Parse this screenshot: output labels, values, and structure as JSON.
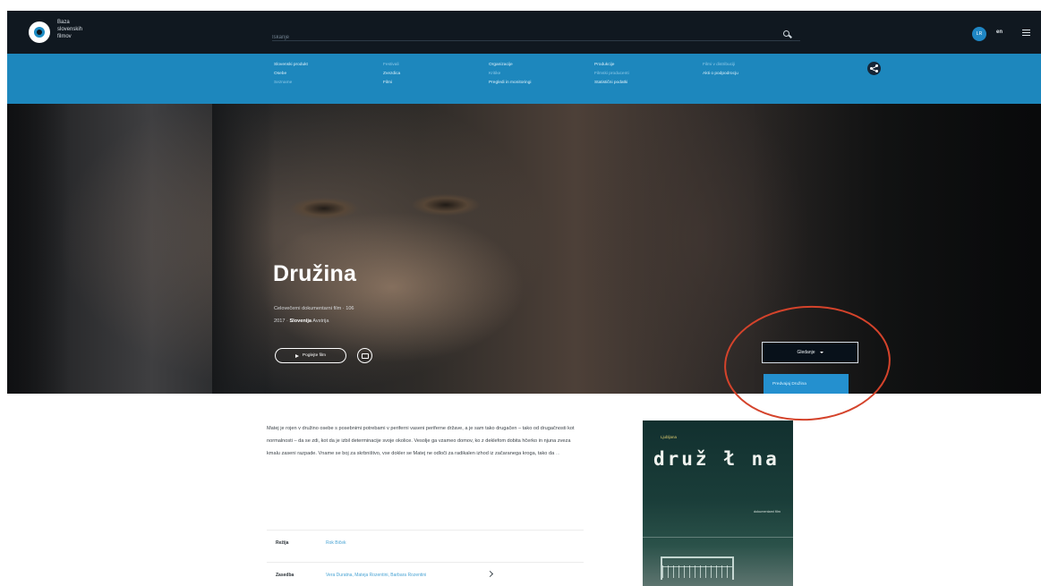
{
  "header": {
    "brand_lines": [
      "Baza",
      "slovenskih",
      "filmov"
    ],
    "search_placeholder": "Iskanje",
    "user_initials": "LR",
    "language": "en"
  },
  "nav": {
    "columns": [
      {
        "items": [
          {
            "label": "Slovenski produkt",
            "dim": false
          },
          {
            "label": "Osebe",
            "dim": false
          },
          {
            "label": "Sezname",
            "dim": true
          }
        ]
      },
      {
        "items": [
          {
            "label": "Festivali",
            "dim": true
          },
          {
            "label": "Zvezdica",
            "dim": false
          },
          {
            "label": "Filmi",
            "dim": false
          }
        ]
      },
      {
        "items": [
          {
            "label": "Organizacije",
            "dim": false
          },
          {
            "label": "Kritike",
            "dim": true
          },
          {
            "label": "Pregledi in monitoringi",
            "dim": false
          }
        ]
      },
      {
        "items": [
          {
            "label": "Produkcije",
            "dim": false
          },
          {
            "label": "Filmski producenti",
            "dim": true
          },
          {
            "label": "Statistični podatki",
            "dim": false
          }
        ]
      },
      {
        "items": [
          {
            "label": "Filmi v distribuciji",
            "dim": true
          },
          {
            "label": "Akti o podpodrocju",
            "dim": false
          }
        ]
      }
    ]
  },
  "hero": {
    "title": "Družina",
    "meta_line1": "Celovečerni dokumentarni film  ·  106",
    "meta_year": "2017",
    "meta_country": "Slovenija",
    "meta_extra": "Avstrija",
    "watch_label": "Poglejte film",
    "dropdown_label": "Gledanje",
    "dropdown_option": "Predvajaj Družina"
  },
  "content": {
    "synopsis": "Matej je rojen v družino osebe s posebnimi potrebami v periferni vaseni periferne države, a je sam tako drugačen – tako od drugačnosti kot normalnosti – da se zdi, kot da je izbil determinacije svoje okolice. Vesolje ga vzameo domov, ko z deklefom dobita hčerko in njuna zveza kmalu zaseni razpade. Vname se boj za skrbništvo, vse dokler se Matej ne odloči za radikalen izhod iz začaranega kroga, tako da",
    "more_label": "...",
    "meta_rows": [
      {
        "label": "Režija",
        "value": "Rok Biček"
      },
      {
        "label": "Zasedba",
        "value": "Vera Duratna, Mateja Rozentini, Barbara Rozentini"
      }
    ]
  },
  "poster": {
    "top_text": "Ljubljana",
    "title": "druž ł na",
    "subtitle": "dokumentarni film"
  },
  "colors": {
    "topbar_bg": "#101820",
    "nav_bg": "#1d87bd",
    "accent": "#2490cf",
    "annotation": "#d4432b"
  },
  "icons": [
    "logo-icon",
    "search-icon",
    "menu-icon",
    "share-icon",
    "play-icon",
    "watchlist-icon",
    "chevron-down-icon",
    "expand-icon"
  ]
}
